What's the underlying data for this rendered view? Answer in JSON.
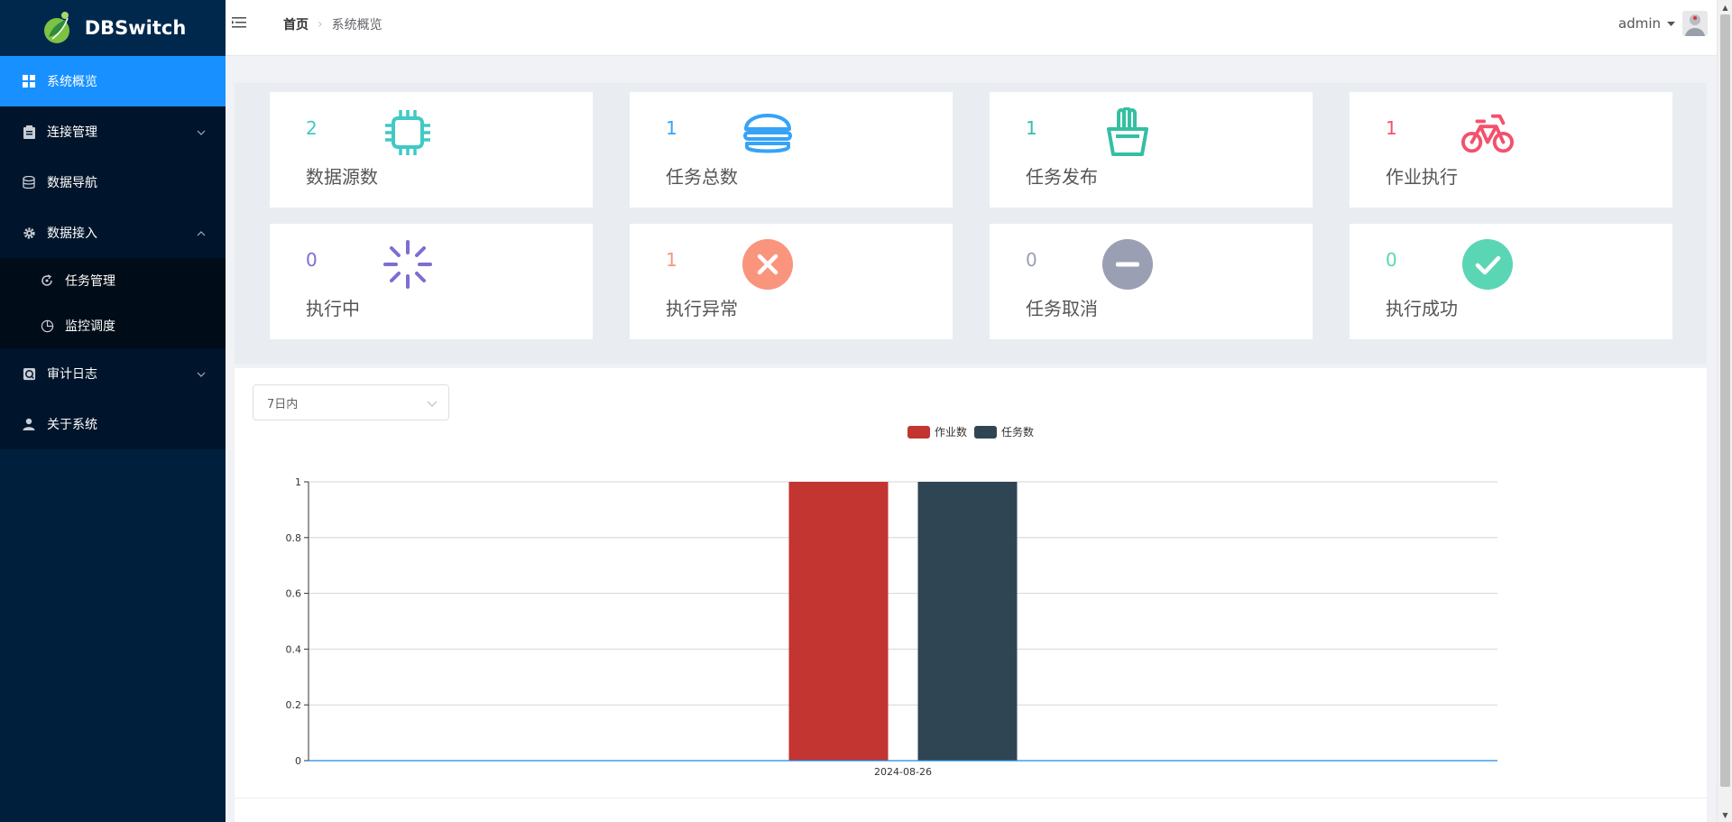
{
  "app": {
    "name": "DBSwitch"
  },
  "sidebar": {
    "items": [
      {
        "label": "系统概览",
        "icon": "dashboard-icon",
        "active": true
      },
      {
        "label": "连接管理",
        "icon": "clipboard-icon",
        "expanded": false
      },
      {
        "label": "数据导航",
        "icon": "database-icon"
      },
      {
        "label": "数据接入",
        "icon": "gear-icon",
        "expanded": true,
        "children": [
          {
            "label": "任务管理",
            "icon": "refresh-icon"
          },
          {
            "label": "监控调度",
            "icon": "pie-icon"
          }
        ]
      },
      {
        "label": "审计日志",
        "icon": "audit-icon",
        "expanded": false
      },
      {
        "label": "关于系统",
        "icon": "user-icon"
      }
    ]
  },
  "header": {
    "breadcrumb_home": "首页",
    "breadcrumb_current": "系统概览",
    "username": "admin"
  },
  "cards": [
    {
      "value": "2",
      "label": "数据源数",
      "icon": "chip-icon",
      "color": "#40c9c6"
    },
    {
      "value": "1",
      "label": "任务总数",
      "icon": "burger-icon",
      "color": "#36a3f7"
    },
    {
      "value": "1",
      "label": "任务发布",
      "icon": "fries-icon",
      "color": "#34bfa3"
    },
    {
      "value": "1",
      "label": "作业执行",
      "icon": "bicycle-icon",
      "color": "#f4516c"
    },
    {
      "value": "0",
      "label": "执行中",
      "icon": "spinner-icon",
      "color": "#7b6fd0"
    },
    {
      "value": "1",
      "label": "执行异常",
      "icon": "error-icon",
      "color": "#f9957d"
    },
    {
      "value": "0",
      "label": "任务取消",
      "icon": "minus-icon",
      "color": "#9b9fb3"
    },
    {
      "value": "0",
      "label": "执行成功",
      "icon": "check-icon",
      "color": "#5bd6b5"
    }
  ],
  "filter": {
    "selected": "7日内"
  },
  "chart_data": {
    "type": "bar",
    "categories": [
      "2024-08-26"
    ],
    "series": [
      {
        "name": "作业数",
        "values": [
          1
        ],
        "color": "#c23531"
      },
      {
        "name": "任务数",
        "values": [
          1
        ],
        "color": "#2f4554"
      }
    ],
    "ylim": [
      0,
      1
    ],
    "yticks": [
      "0",
      "0.2",
      "0.4",
      "0.6",
      "0.8",
      "1"
    ],
    "legend_position": "top-center",
    "grid": true
  }
}
